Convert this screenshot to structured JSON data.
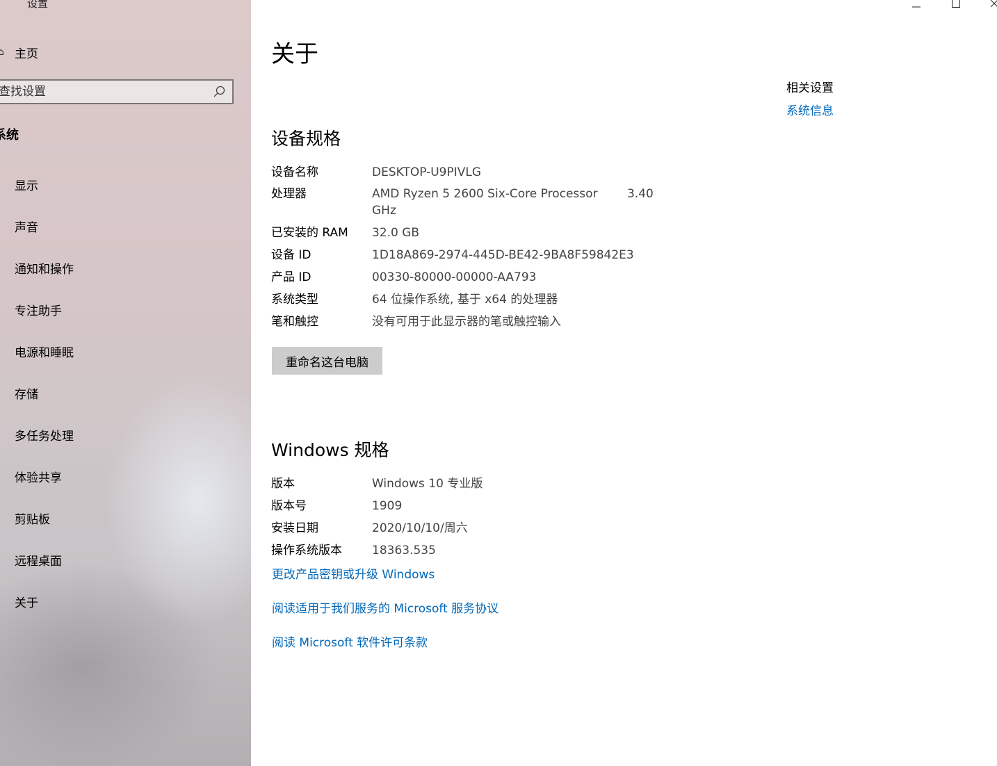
{
  "window": {
    "title": "设置"
  },
  "sidebar": {
    "home_label": "主页",
    "search_placeholder": "查找设置",
    "section_header": "系统",
    "items": [
      {
        "label": "显示",
        "icon": "display-icon"
      },
      {
        "label": "声音",
        "icon": "speaker-icon"
      },
      {
        "label": "通知和操作",
        "icon": "notification-icon"
      },
      {
        "label": "专注助手",
        "icon": "moon-icon"
      },
      {
        "label": "电源和睡眠",
        "icon": "power-icon"
      },
      {
        "label": "存储",
        "icon": "storage-icon"
      },
      {
        "label": "多任务处理",
        "icon": "multitasking-icon"
      },
      {
        "label": "体验共享",
        "icon": "share-icon"
      },
      {
        "label": "剪贴板",
        "icon": "clipboard-icon"
      },
      {
        "label": "远程桌面",
        "icon": "remote-desktop-icon"
      },
      {
        "label": "关于",
        "icon": "info-icon"
      }
    ]
  },
  "main": {
    "title": "关于",
    "device_spec": {
      "heading": "设备规格",
      "rows": [
        {
          "label": "设备名称",
          "value": "DESKTOP-U9PIVLG"
        },
        {
          "label": "处理器",
          "value": "AMD Ryzen 5 2600 Six-Core Processor",
          "value_extra": "3.40",
          "value_wrap": "GHz"
        },
        {
          "label": "已安装的 RAM",
          "value": "32.0 GB"
        },
        {
          "label": "设备 ID",
          "value": "1D18A869-2974-445D-BE42-9BA8F59842E3"
        },
        {
          "label": "产品 ID",
          "value": "00330-80000-00000-AA793"
        },
        {
          "label": "系统类型",
          "value": "64 位操作系统, 基于 x64 的处理器"
        },
        {
          "label": "笔和触控",
          "value": "没有可用于此显示器的笔或触控输入"
        }
      ],
      "rename_button": "重命名这台电脑"
    },
    "windows_spec": {
      "heading": "Windows 规格",
      "rows": [
        {
          "label": "版本",
          "value": "Windows 10 专业版"
        },
        {
          "label": "版本号",
          "value": "1909"
        },
        {
          "label": "安装日期",
          "value": "2020/10/10/周六"
        },
        {
          "label": "操作系统版本",
          "value": "18363.535"
        }
      ]
    },
    "links": [
      "更改产品密钥或升级 Windows",
      "阅读适用于我们服务的 Microsoft 服务协议",
      "阅读 Microsoft 软件许可条款"
    ],
    "related": {
      "title": "相关设置",
      "link": "系统信息"
    }
  },
  "colors": {
    "link": "#0067b8",
    "button_bg": "#cccccc",
    "sidebar_tint": "#dccacb"
  }
}
